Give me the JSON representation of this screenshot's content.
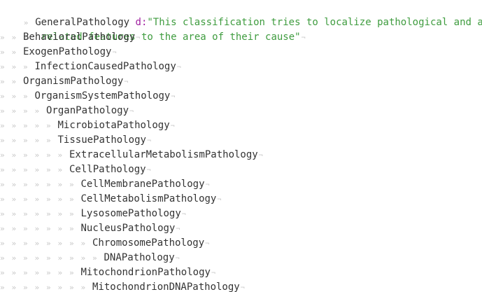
{
  "root": {
    "name": "GeneralPathology",
    "attr_key": "d:",
    "description_line1": "\"This classification tries to localize pathological and age-",
    "description_line2": "related features to the area of their cause\""
  },
  "tree": [
    {
      "depth": 1,
      "label": "BehavioralPathology"
    },
    {
      "depth": 1,
      "label": "ExogenPathology"
    },
    {
      "depth": 2,
      "label": "InfectionCausedPathology"
    },
    {
      "depth": 1,
      "label": "OrganismPathology"
    },
    {
      "depth": 2,
      "label": "OrganismSystemPathology"
    },
    {
      "depth": 3,
      "label": "OrganPathology"
    },
    {
      "depth": 4,
      "label": "MicrobiotaPathology"
    },
    {
      "depth": 4,
      "label": "TissuePathology"
    },
    {
      "depth": 5,
      "label": "ExtracellularMetabolismPathology"
    },
    {
      "depth": 5,
      "label": "CellPathology"
    },
    {
      "depth": 6,
      "label": "CellMembranePathology"
    },
    {
      "depth": 6,
      "label": "CellMetabolismPathology"
    },
    {
      "depth": 6,
      "label": "LysosomePathology"
    },
    {
      "depth": 6,
      "label": "NucleusPathology"
    },
    {
      "depth": 7,
      "label": "ChromosomePathology"
    },
    {
      "depth": 8,
      "label": "DNAPathology"
    },
    {
      "depth": 6,
      "label": "MitochondrionPathology"
    },
    {
      "depth": 7,
      "label": "MitochondrionDNAPathology"
    }
  ],
  "colors": {
    "text": "#333333",
    "attribute_key": "#a020a0",
    "string": "#3f9c3f",
    "whitespace_markers": "#c8c8c8"
  },
  "icons": {
    "indent_marker": "guillemet-indent-icon",
    "eol_marker": "pilcrow-eol-icon"
  }
}
